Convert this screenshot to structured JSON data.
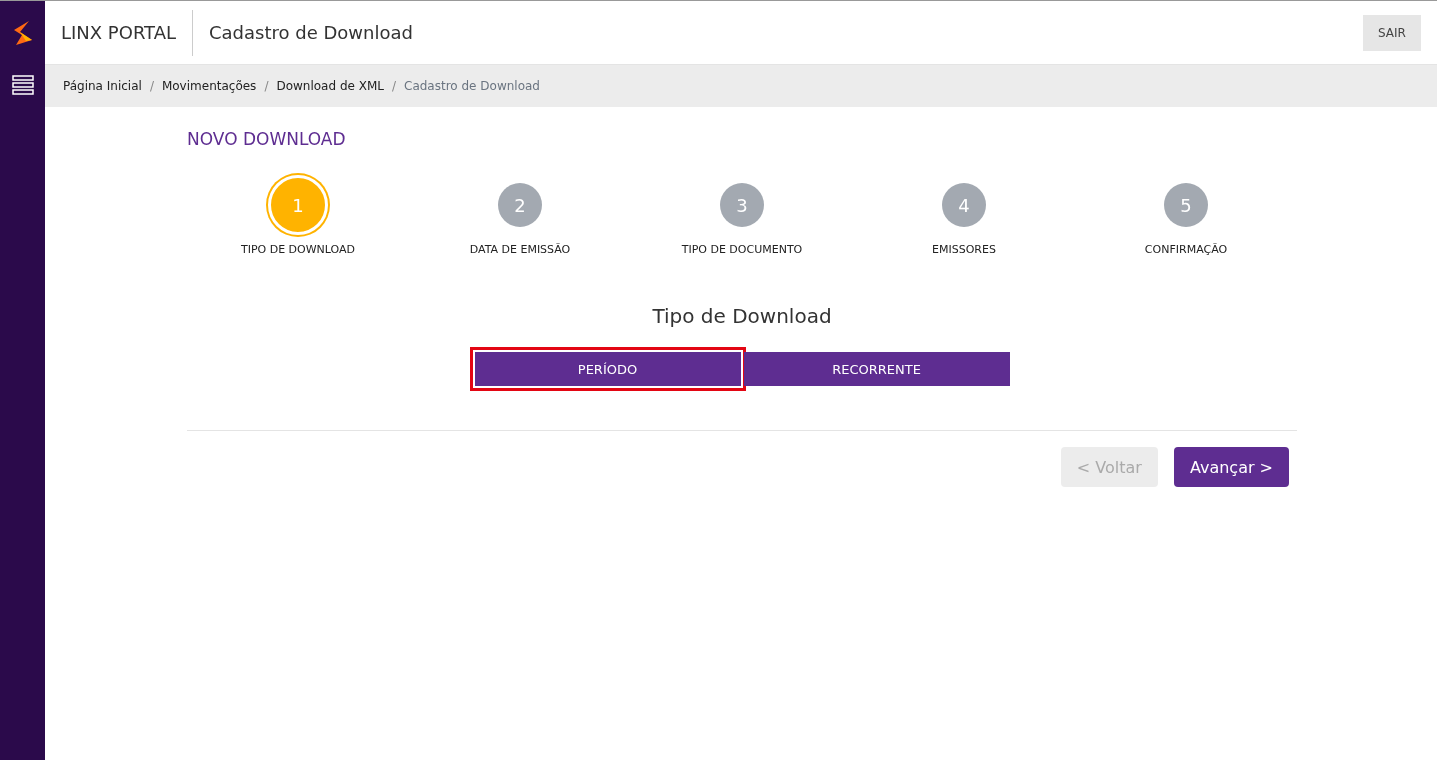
{
  "header": {
    "brand": "LINX PORTAL",
    "title": "Cadastro de Download",
    "logout": "SAIR"
  },
  "breadcrumb": [
    {
      "label": "Página Inicial",
      "current": false
    },
    {
      "separator": "/",
      "label": "Movimentações",
      "current": false
    },
    {
      "separator": "/",
      "label": "Download de XML",
      "current": false
    },
    {
      "separator": "/",
      "label": "Cadastro de Download",
      "current": true
    }
  ],
  "page_title": "NOVO DOWNLOAD",
  "steps": [
    {
      "number": "1",
      "label": "TIPO DE DOWNLOAD",
      "selected": true
    },
    {
      "number": "2",
      "label": "DATA DE EMISSÃO",
      "selected": false
    },
    {
      "number": "3",
      "label": "TIPO DE DOCUMENTO",
      "selected": false
    },
    {
      "number": "4",
      "label": "EMISSORES",
      "selected": false
    },
    {
      "number": "5",
      "label": "CONFIRMAÇÃO",
      "selected": false
    }
  ],
  "section_title": "Tipo de Download",
  "options": [
    {
      "label": "PERÍODO",
      "selected": true
    },
    {
      "label": "RECORRENTE",
      "selected": false
    }
  ],
  "back_button": {
    "label": "< Voltar",
    "disabled": true
  },
  "next_button": {
    "label": "Avançar >",
    "disabled": false
  }
}
